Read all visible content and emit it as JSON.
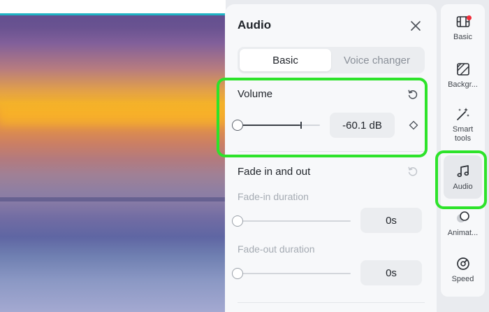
{
  "panel": {
    "title": "Audio",
    "tabs": [
      {
        "label": "Basic",
        "active": true
      },
      {
        "label": "Voice changer",
        "active": false
      }
    ]
  },
  "volume": {
    "label": "Volume",
    "value_text": "-60.1 dB",
    "level": 0.0
  },
  "fade": {
    "label": "Fade in and out",
    "fade_in_label": "Fade-in duration",
    "fade_in_value": "0s",
    "fade_out_label": "Fade-out duration",
    "fade_out_value": "0s"
  },
  "toolbar": {
    "items": [
      {
        "label": "Basic",
        "icon": "film-icon",
        "badge": true
      },
      {
        "label": "Backgr...",
        "icon": "background-icon"
      },
      {
        "label": "Smart tools",
        "icon": "magic-wand-icon"
      },
      {
        "label": "Audio",
        "icon": "music-note-icon",
        "active": true
      },
      {
        "label": "Animat...",
        "icon": "animation-icon"
      },
      {
        "label": "Speed",
        "icon": "speed-icon"
      }
    ]
  },
  "colors": {
    "highlight": "#2de32a",
    "badge": "#f02d3a",
    "accent_strip": "#1fb3c4"
  }
}
